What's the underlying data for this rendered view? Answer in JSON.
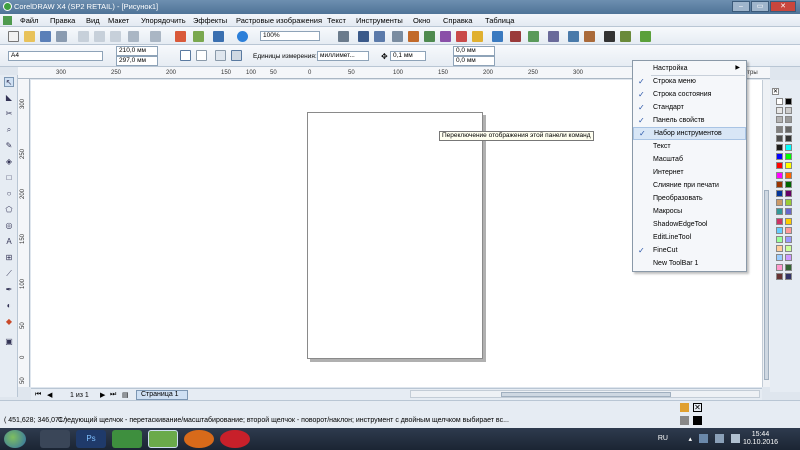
{
  "window": {
    "title": "CorelDRAW X4 (SP2 RETAIL) - [Рисунок1]",
    "buttons": [
      "–",
      "▭",
      "✕"
    ]
  },
  "menubar": {
    "items": [
      "Файл",
      "Правка",
      "Вид",
      "Макет",
      "Упорядочить",
      "Эффекты",
      "Растровые изображения",
      "Текст",
      "Инструменты",
      "Окно",
      "Справка",
      "Таблица"
    ]
  },
  "toolbar": {
    "zoom": "100%"
  },
  "property_bar": {
    "paper_size": "A4",
    "width": "210,0 мм",
    "height": "297,0 мм",
    "units_label": "Единицы измерения:",
    "units_value": "миллимет...",
    "nudge": "0,1 мм",
    "dup_x": "0,0 мм",
    "dup_y": "0,0 мм"
  },
  "ruler": {
    "h_labels": [
      "300",
      "250",
      "200",
      "150",
      "100",
      "50",
      "0",
      "50",
      "100",
      "150",
      "200",
      "250",
      "300"
    ],
    "v_labels": [
      "300",
      "250",
      "200",
      "150",
      "100",
      "50",
      "0",
      "50"
    ],
    "units_caption": "метры"
  },
  "tooltip": "Переключение отображения этой панели команд",
  "context_menu": {
    "items": [
      {
        "label": "Настройка",
        "checked": false,
        "submenu": true
      },
      {
        "label": "Строка меню",
        "checked": true
      },
      {
        "label": "Строка состояния",
        "checked": true
      },
      {
        "label": "Стандарт",
        "checked": true
      },
      {
        "label": "Панель свойств",
        "checked": true
      },
      {
        "label": "Набор инструментов",
        "checked": true,
        "highlighted": true
      },
      {
        "label": "Текст",
        "checked": false
      },
      {
        "label": "Масштаб",
        "checked": false
      },
      {
        "label": "Интернет",
        "checked": false
      },
      {
        "label": "Слияние при печати",
        "checked": false
      },
      {
        "label": "Преобразовать",
        "checked": false
      },
      {
        "label": "Макросы",
        "checked": false
      },
      {
        "label": "ShadowEdgeTool",
        "checked": false
      },
      {
        "label": "EditLineTool",
        "checked": false
      },
      {
        "label": "FineCut",
        "checked": true
      },
      {
        "label": "New ToolBar 1",
        "checked": false
      }
    ]
  },
  "pagenav": {
    "counter": "1 из 1",
    "tab": "Страница 1"
  },
  "statusbar": {
    "coords": "( 451,628; 346,071 )",
    "message": "Следующий щелчок - перетаскивание/масштабирование; второй щелчок - поворот/наклон; инструмент с двойным щелчком выбирает вс..."
  },
  "taskbar": {
    "apps": [
      "corel",
      "photoshop",
      "coreldraw",
      "corel-2",
      "firefox",
      "wps"
    ],
    "lang": "RU",
    "time": "15:44",
    "date": "10.10.2016"
  },
  "colors": {
    "palette": [
      "#ffffff",
      "#000000",
      "#e6e6e6",
      "#cccccc",
      "#b3b3b3",
      "#999999",
      "#808080",
      "#666666",
      "#4d4d4d",
      "#333333",
      "#1a1a1a",
      "#00ffff",
      "#0000ff",
      "#00ff00",
      "#ff0000",
      "#ffff00",
      "#ff00ff",
      "#ff6600",
      "#993300",
      "#006600",
      "#003399",
      "#660066",
      "#cc9966",
      "#99cc33",
      "#339999",
      "#6666cc",
      "#cc3366",
      "#ffcc00",
      "#66ccff",
      "#ff9999",
      "#99ff99",
      "#9999ff",
      "#ffcc99",
      "#ccff99",
      "#99ccff",
      "#cc99ff",
      "#ff99cc",
      "#336633",
      "#663333",
      "#333366"
    ]
  }
}
